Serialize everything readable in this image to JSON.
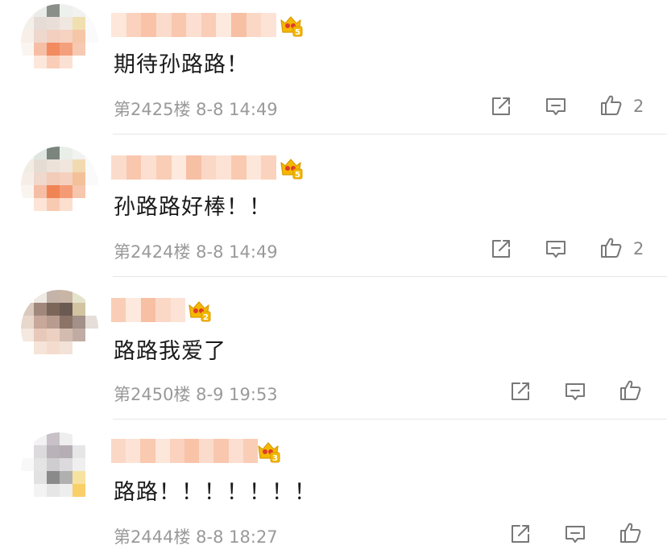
{
  "comments": [
    {
      "text": "期待孙路路！",
      "floor_label": "第2425楼",
      "date": "8-8",
      "time": "14:49",
      "likes": "2",
      "badge_level": "5"
    },
    {
      "text": "孙路路好棒！！",
      "floor_label": "第2424楼",
      "date": "8-8",
      "time": "14:49",
      "likes": "2",
      "badge_level": "5"
    },
    {
      "text": "路路我爱了",
      "floor_label": "第2450楼",
      "date": "8-9",
      "time": "19:53",
      "likes": "",
      "badge_level": "2"
    },
    {
      "text": "路路！！！！！！！",
      "floor_label": "第2444楼",
      "date": "8-8",
      "time": "18:27",
      "likes": "",
      "badge_level": "3"
    }
  ],
  "colors": {
    "text": "#1a1a1a",
    "meta": "#9a9a9a",
    "icon": "#777777",
    "crown_gold": "#f5b800",
    "crown_red": "#e03a2f",
    "blur_name": "#f8c9b0"
  },
  "icons": [
    "share-icon",
    "reply-icon",
    "like-icon",
    "crown-badge-icon"
  ]
}
